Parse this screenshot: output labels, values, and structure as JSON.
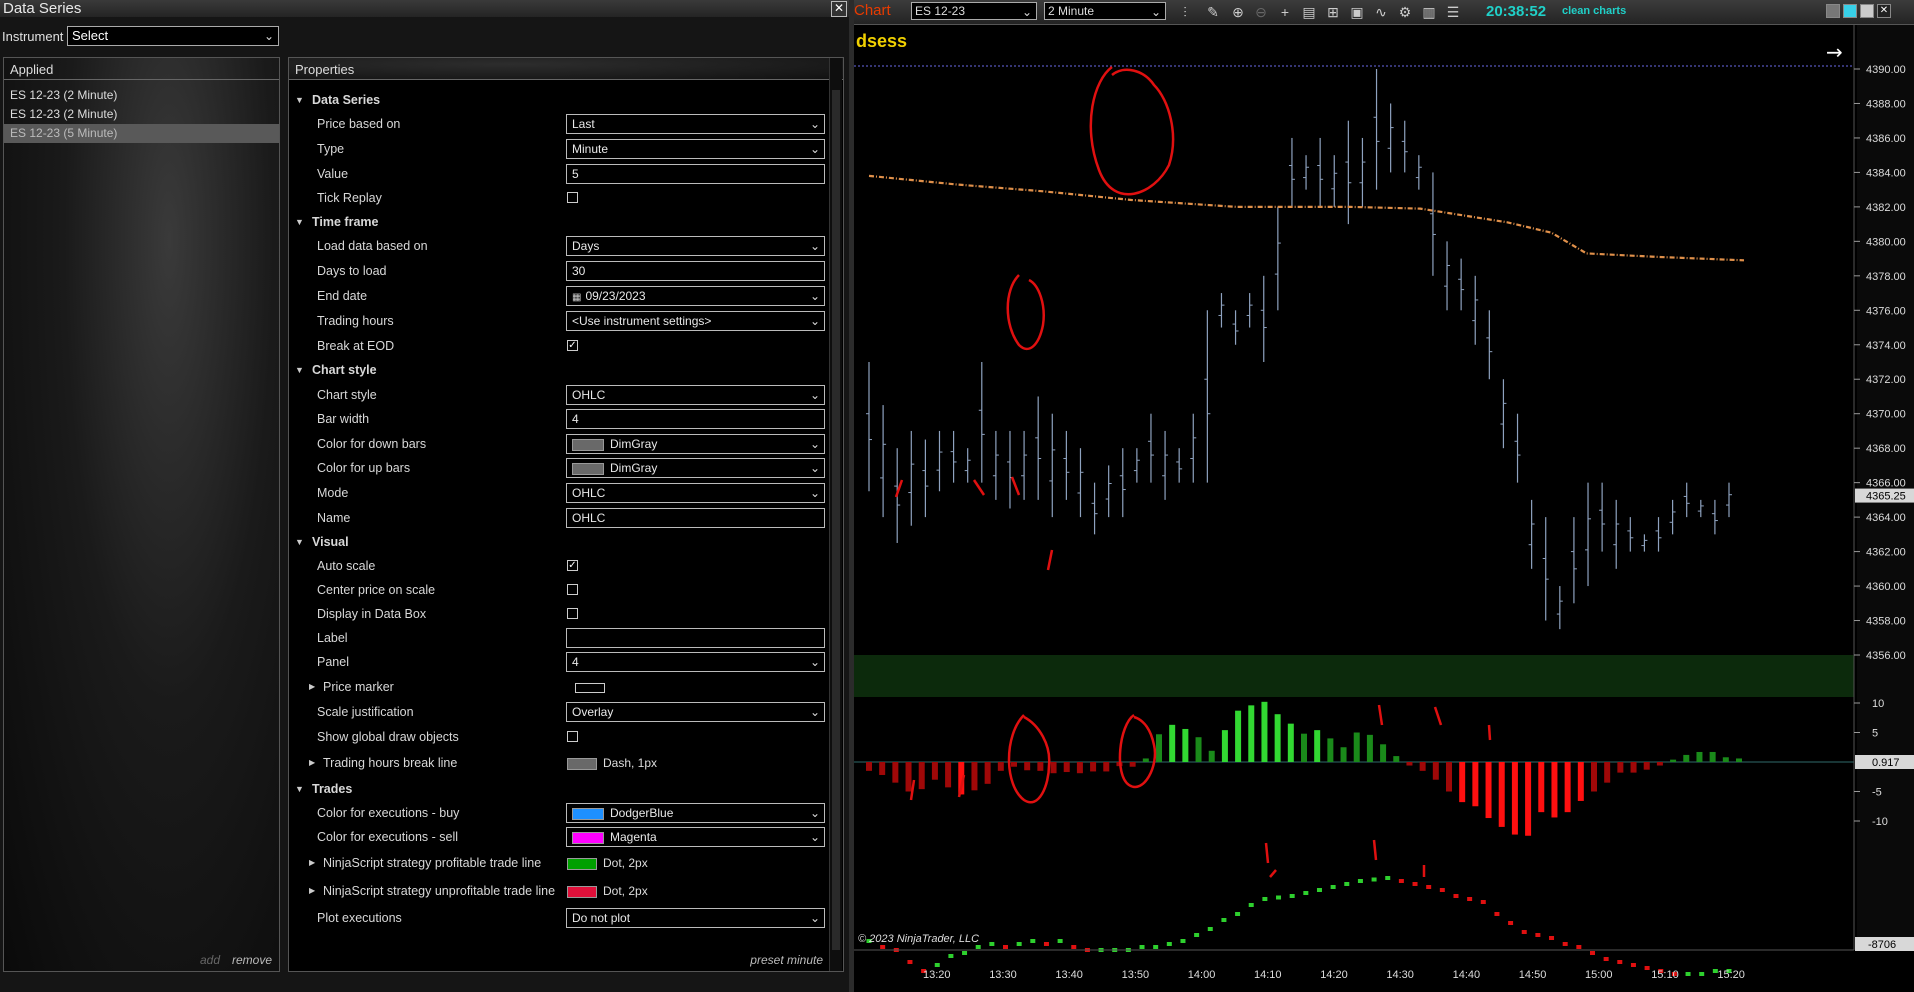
{
  "dialog": {
    "title": "Data Series",
    "instrument_label": "Instrument",
    "instrument_value": "Select",
    "applied_header": "Applied",
    "applied_items": [
      "ES 12-23 (2 Minute)",
      "ES 12-23 (2 Minute)",
      "ES 12-23 (5 Minute)"
    ],
    "add_label": "add",
    "remove_label": "remove",
    "properties_header": "Properties",
    "preset_label": "preset minute"
  },
  "properties": {
    "cat_data_series": "Data Series",
    "price_based_on_label": "Price based on",
    "price_based_on_value": "Last",
    "type_label": "Type",
    "type_value": "Minute",
    "value_label": "Value",
    "value_value": "5",
    "tick_replay_label": "Tick Replay",
    "cat_time_frame": "Time frame",
    "load_data_label": "Load data based on",
    "load_data_value": "Days",
    "days_to_load_label": "Days to load",
    "days_to_load_value": "30",
    "end_date_label": "End date",
    "end_date_value": "09/23/2023",
    "trading_hours_label": "Trading hours",
    "trading_hours_value": "<Use instrument settings>",
    "break_eod_label": "Break at EOD",
    "cat_chart_style": "Chart style",
    "chart_style_label": "Chart style",
    "chart_style_value": "OHLC",
    "bar_width_label": "Bar width",
    "bar_width_value": "4",
    "down_bars_label": "Color for down bars",
    "down_bars_value": "DimGray",
    "up_bars_label": "Color for up bars",
    "up_bars_value": "DimGray",
    "mode_label": "Mode",
    "mode_value": "OHLC",
    "name_label": "Name",
    "name_value": "OHLC",
    "cat_visual": "Visual",
    "auto_scale_label": "Auto scale",
    "center_price_label": "Center price on scale",
    "data_box_label": "Display in Data Box",
    "label_label": "Label",
    "label_value": "",
    "panel_label": "Panel",
    "panel_value": "4",
    "price_marker_label": "Price marker",
    "scale_just_label": "Scale justification",
    "scale_just_value": "Overlay",
    "global_draw_label": "Show global draw objects",
    "th_break_line_label": "Trading hours break line",
    "th_break_line_value": "Dash, 1px",
    "cat_trades": "Trades",
    "exec_buy_label": "Color for executions - buy",
    "exec_buy_value": "DodgerBlue",
    "exec_sell_label": "Color for executions - sell",
    "exec_sell_value": "Magenta",
    "profit_line_label": "NinjaScript strategy profitable trade line",
    "profit_line_value": "Dot, 2px",
    "unprofit_line_label": "NinjaScript strategy unprofitable trade line",
    "unprofit_line_value": "Dot, 2px",
    "plot_exec_label": "Plot executions",
    "plot_exec_value": "Do not plot"
  },
  "colors": {
    "dimgray": "#696969",
    "dodgerblue": "#1e90ff",
    "magenta": "#ff00ff",
    "profit_green": "#00a000",
    "unprofit_red": "#e0103a",
    "price_bars": "#8ea2bf",
    "vwap_orange": "#e0904a",
    "annotation_red": "#e01010",
    "osc_green": "#2ed02e",
    "osc_red": "#e01010",
    "clock_cyan": "#20d0c8"
  },
  "toolbar": {
    "title": "Chart",
    "instrument": "ES 12-23",
    "interval": "2 Minute",
    "clock": "20:38:52",
    "clean_label": "clean charts"
  },
  "chart_data": {
    "type": "ohlc",
    "panel_label": "dsess",
    "watermark": "© 2023 NinjaTrader, LLC",
    "x_ticks": [
      "13:20",
      "13:30",
      "13:40",
      "13:50",
      "14:00",
      "14:10",
      "14:20",
      "14:30",
      "14:40",
      "14:50",
      "15:00",
      "15:10",
      "15:20"
    ],
    "price_axis": {
      "ticks": [
        "4390.00",
        "4388.00",
        "4386.00",
        "4384.00",
        "4382.00",
        "4380.00",
        "4378.00",
        "4376.00",
        "4374.00",
        "4372.00",
        "4370.00",
        "4368.00",
        "4366.00",
        "4364.00",
        "4362.00",
        "4360.00",
        "4358.00",
        "4356.00"
      ],
      "ylim": [
        4355,
        4390.5
      ],
      "last_price": "4365.25"
    },
    "osc_axis": {
      "ticks": [
        "10",
        "5",
        "-5",
        "-10"
      ],
      "last_value": "0.917"
    },
    "vol_axis": {
      "last_value": "-8706"
    },
    "bars": [
      [
        4373,
        4365.5
      ],
      [
        4370.5,
        4364
      ],
      [
        4368,
        4362.5
      ],
      [
        4369,
        4363.5
      ],
      [
        4368.5,
        4364
      ],
      [
        4369,
        4365.5
      ],
      [
        4369,
        4366
      ],
      [
        4368,
        4366
      ],
      [
        4373,
        4366
      ],
      [
        4369,
        4365
      ],
      [
        4369,
        4364.5
      ],
      [
        4369,
        4365
      ],
      [
        4371,
        4365
      ],
      [
        4370,
        4364
      ],
      [
        4369,
        4365
      ],
      [
        4368,
        4364
      ],
      [
        4366,
        4363
      ],
      [
        4367,
        4364
      ],
      [
        4368,
        4364
      ],
      [
        4368,
        4366
      ],
      [
        4370,
        4366
      ],
      [
        4369,
        4365
      ],
      [
        4368,
        4366
      ],
      [
        4370,
        4366
      ],
      [
        4376,
        4366
      ],
      [
        4377,
        4375
      ],
      [
        4376,
        4374
      ],
      [
        4377,
        4375
      ],
      [
        4378,
        4373
      ],
      [
        4382,
        4376
      ],
      [
        4386,
        4382
      ],
      [
        4385,
        4383
      ],
      [
        4386,
        4382
      ],
      [
        4385,
        4382
      ],
      [
        4387,
        4381
      ],
      [
        4386,
        4382
      ],
      [
        4390,
        4383
      ],
      [
        4388,
        4384
      ],
      [
        4387,
        4384
      ],
      [
        4385,
        4383
      ],
      [
        4384,
        4378
      ],
      [
        4380,
        4376
      ],
      [
        4379,
        4376
      ],
      [
        4378,
        4374
      ],
      [
        4376,
        4372
      ],
      [
        4372,
        4368
      ],
      [
        4370,
        4366
      ],
      [
        4365,
        4361
      ],
      [
        4364,
        4358
      ],
      [
        4360,
        4357.5
      ],
      [
        4364,
        4359
      ],
      [
        4366,
        4360
      ],
      [
        4366,
        4362
      ],
      [
        4365,
        4361
      ],
      [
        4364,
        4362
      ],
      [
        4363,
        4362
      ],
      [
        4364,
        4362
      ],
      [
        4365,
        4363
      ],
      [
        4366,
        4364
      ],
      [
        4365,
        4364
      ],
      [
        4365,
        4363
      ],
      [
        4366,
        4364
      ]
    ],
    "vwap": [
      [
        0,
        4383.8
      ],
      [
        0.1,
        4383.3
      ],
      [
        0.2,
        4382.9
      ],
      [
        0.3,
        4382.4
      ],
      [
        0.42,
        4382
      ],
      [
        0.55,
        4382
      ],
      [
        0.63,
        4381.9
      ],
      [
        0.73,
        4381.1
      ],
      [
        0.78,
        4380.5
      ],
      [
        0.82,
        4379.3
      ],
      [
        0.9,
        4379.1
      ],
      [
        1,
        4378.9
      ]
    ],
    "oscillator": [
      -1.5,
      -2.2,
      -3.5,
      -5,
      -4.6,
      -3,
      -4.3,
      -5.5,
      -4.8,
      -3.7,
      -1.5,
      -0.8,
      -1.4,
      -1.5,
      -1.9,
      -1.7,
      -1.9,
      -1.6,
      -1.6,
      -0.7,
      -0.8,
      0.6,
      4.7,
      6.3,
      5.6,
      4.2,
      1.9,
      5.4,
      8.7,
      9.6,
      10.2,
      8.1,
      6.5,
      4.8,
      5.4,
      4,
      2.5,
      5,
      4.6,
      3,
      1,
      -0.6,
      -1.5,
      -3,
      -5,
      -6.8,
      -7.5,
      -9.5,
      -11,
      -12.3,
      -12.5,
      -8.5,
      -9.4,
      -8.5,
      -6.6,
      -5,
      -3.5,
      -1.8,
      -1.8,
      -1.3,
      -0.6,
      0.4,
      1.2,
      1.7,
      1.7,
      0.8,
      0.6
    ],
    "cumulative_delta": [
      -12,
      -14,
      -15,
      -19,
      -22,
      -20,
      -17,
      -16,
      -14,
      -13,
      -14,
      -13,
      -12,
      -13,
      -12,
      -14,
      -15,
      -15,
      -15,
      -15,
      -14,
      -14,
      -13,
      -12,
      -10,
      -8,
      -5,
      -3,
      0,
      2,
      2.5,
      3,
      4,
      5,
      6,
      7,
      8,
      8.5,
      9,
      8,
      7,
      6,
      5,
      3,
      2,
      1,
      -3,
      -6,
      -9,
      -10,
      -11,
      -13,
      -14,
      -16,
      -18,
      -19,
      -20,
      -21,
      -22,
      -23,
      -23,
      -23,
      -22,
      -22
    ]
  }
}
